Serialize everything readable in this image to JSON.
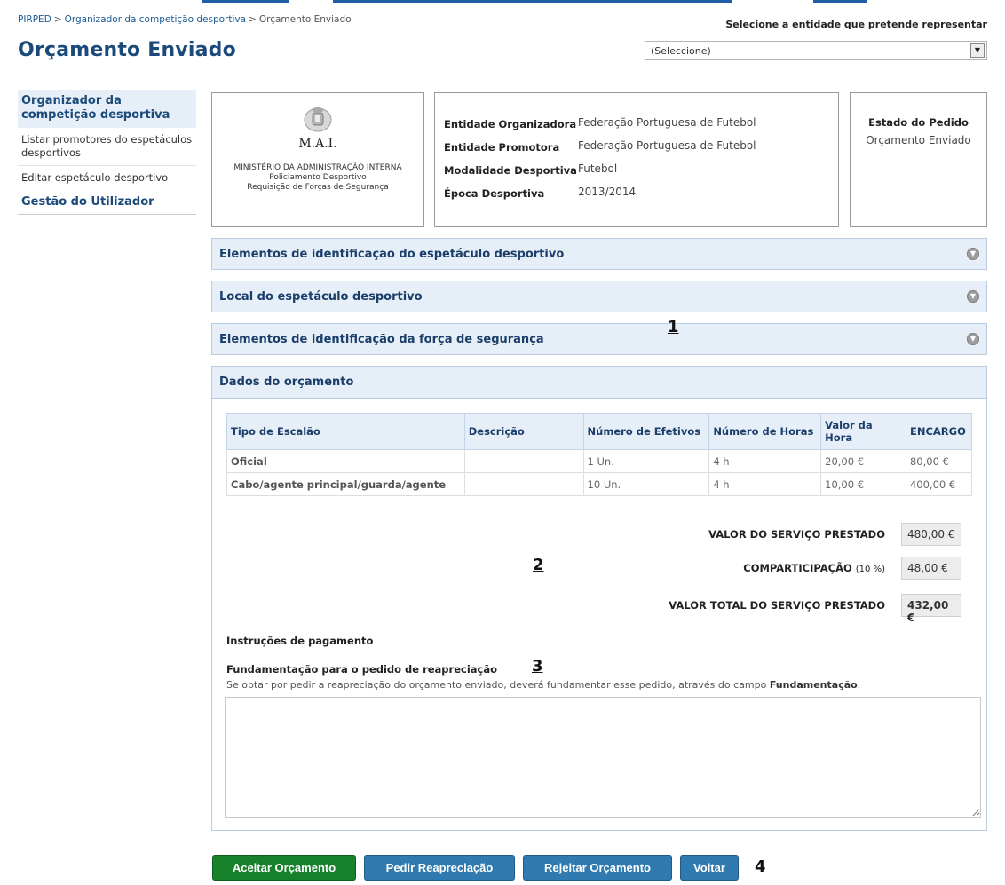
{
  "breadcrumb": {
    "items": [
      "PIRPED",
      "Organizador da competição desportiva",
      "Orçamento Enviado"
    ],
    "separator": ">"
  },
  "page_title": "Orçamento Enviado",
  "entity": {
    "label": "Selecione a entidade que pretende representar",
    "selected": "(Seleccione)"
  },
  "sidebar": {
    "section_title": "Organizador da competição desportiva",
    "items": [
      "Listar promotores do espetáculos desportivos",
      "Editar espetáculo desportivo"
    ],
    "section2_title": "Gestão do Utilizador"
  },
  "logo": {
    "acronym": "M.A.I.",
    "line1": "MINISTÉRIO DA ADMINISTRAÇÃO INTERNA",
    "line2": "Policiamento Desportivo",
    "line3": "Requisição de Forças de Segurança"
  },
  "info": [
    {
      "label": "Entidade Organizadora",
      "value": "Federação Portuguesa de Futebol"
    },
    {
      "label": "Entidade Promotora",
      "value": "Federação Portuguesa de Futebol"
    },
    {
      "label": "Modalidade Desportiva",
      "value": "Futebol"
    },
    {
      "label": "Época Desportiva",
      "value": "2013/2014"
    }
  ],
  "status": {
    "label": "Estado do Pedido",
    "value": "Orçamento Enviado"
  },
  "accordions": [
    "Elementos de identificação do espetáculo desportivo",
    "Local do espetáculo desportivo",
    "Elementos de identificação da força de segurança"
  ],
  "budget": {
    "title": "Dados do orçamento",
    "columns": [
      "Tipo de Escalão",
      "Descrição",
      "Número de Efetivos",
      "Número de Horas",
      "Valor da Hora",
      "ENCARGO"
    ],
    "rows": [
      [
        "Oficial",
        "",
        "1 Un.",
        "4 h",
        "20,00 €",
        "80,00 €"
      ],
      [
        "Cabo/agente principal/guarda/agente",
        "",
        "10 Un.",
        "4 h",
        "10,00 €",
        "400,00 €"
      ]
    ],
    "totals": {
      "service_label": "VALOR DO SERVIÇO PRESTADO",
      "service_value": "480,00 €",
      "comp_label": "COMPARTICIPAÇÃO",
      "comp_pct": "(10 %)",
      "comp_value": "48,00 €",
      "total_label": "VALOR TOTAL DO SERVIÇO PRESTADO",
      "total_value": "432,00 €"
    },
    "payment_instructions": "Instruções de pagamento",
    "fund_title": "Fundamentação para o pedido de reapreciação",
    "fund_help_prefix": "Se optar por pedir a reapreciação do orçamento enviado, deverá fundamentar esse pedido, através do campo ",
    "fund_help_bold": "Fundamentação",
    "fund_help_suffix": ".",
    "fund_value": ""
  },
  "markers": [
    "1",
    "2",
    "3",
    "4"
  ],
  "actions": {
    "accept": "Aceitar Orçamento",
    "reassess": "Pedir Reapreciação",
    "reject": "Rejeitar Orçamento",
    "back": "Voltar"
  },
  "colors": {
    "title_blue": "#1b4a7a",
    "panel_bg": "#e6eef7",
    "accept_green": "#17802a",
    "button_blue": "#2f7ab0"
  }
}
